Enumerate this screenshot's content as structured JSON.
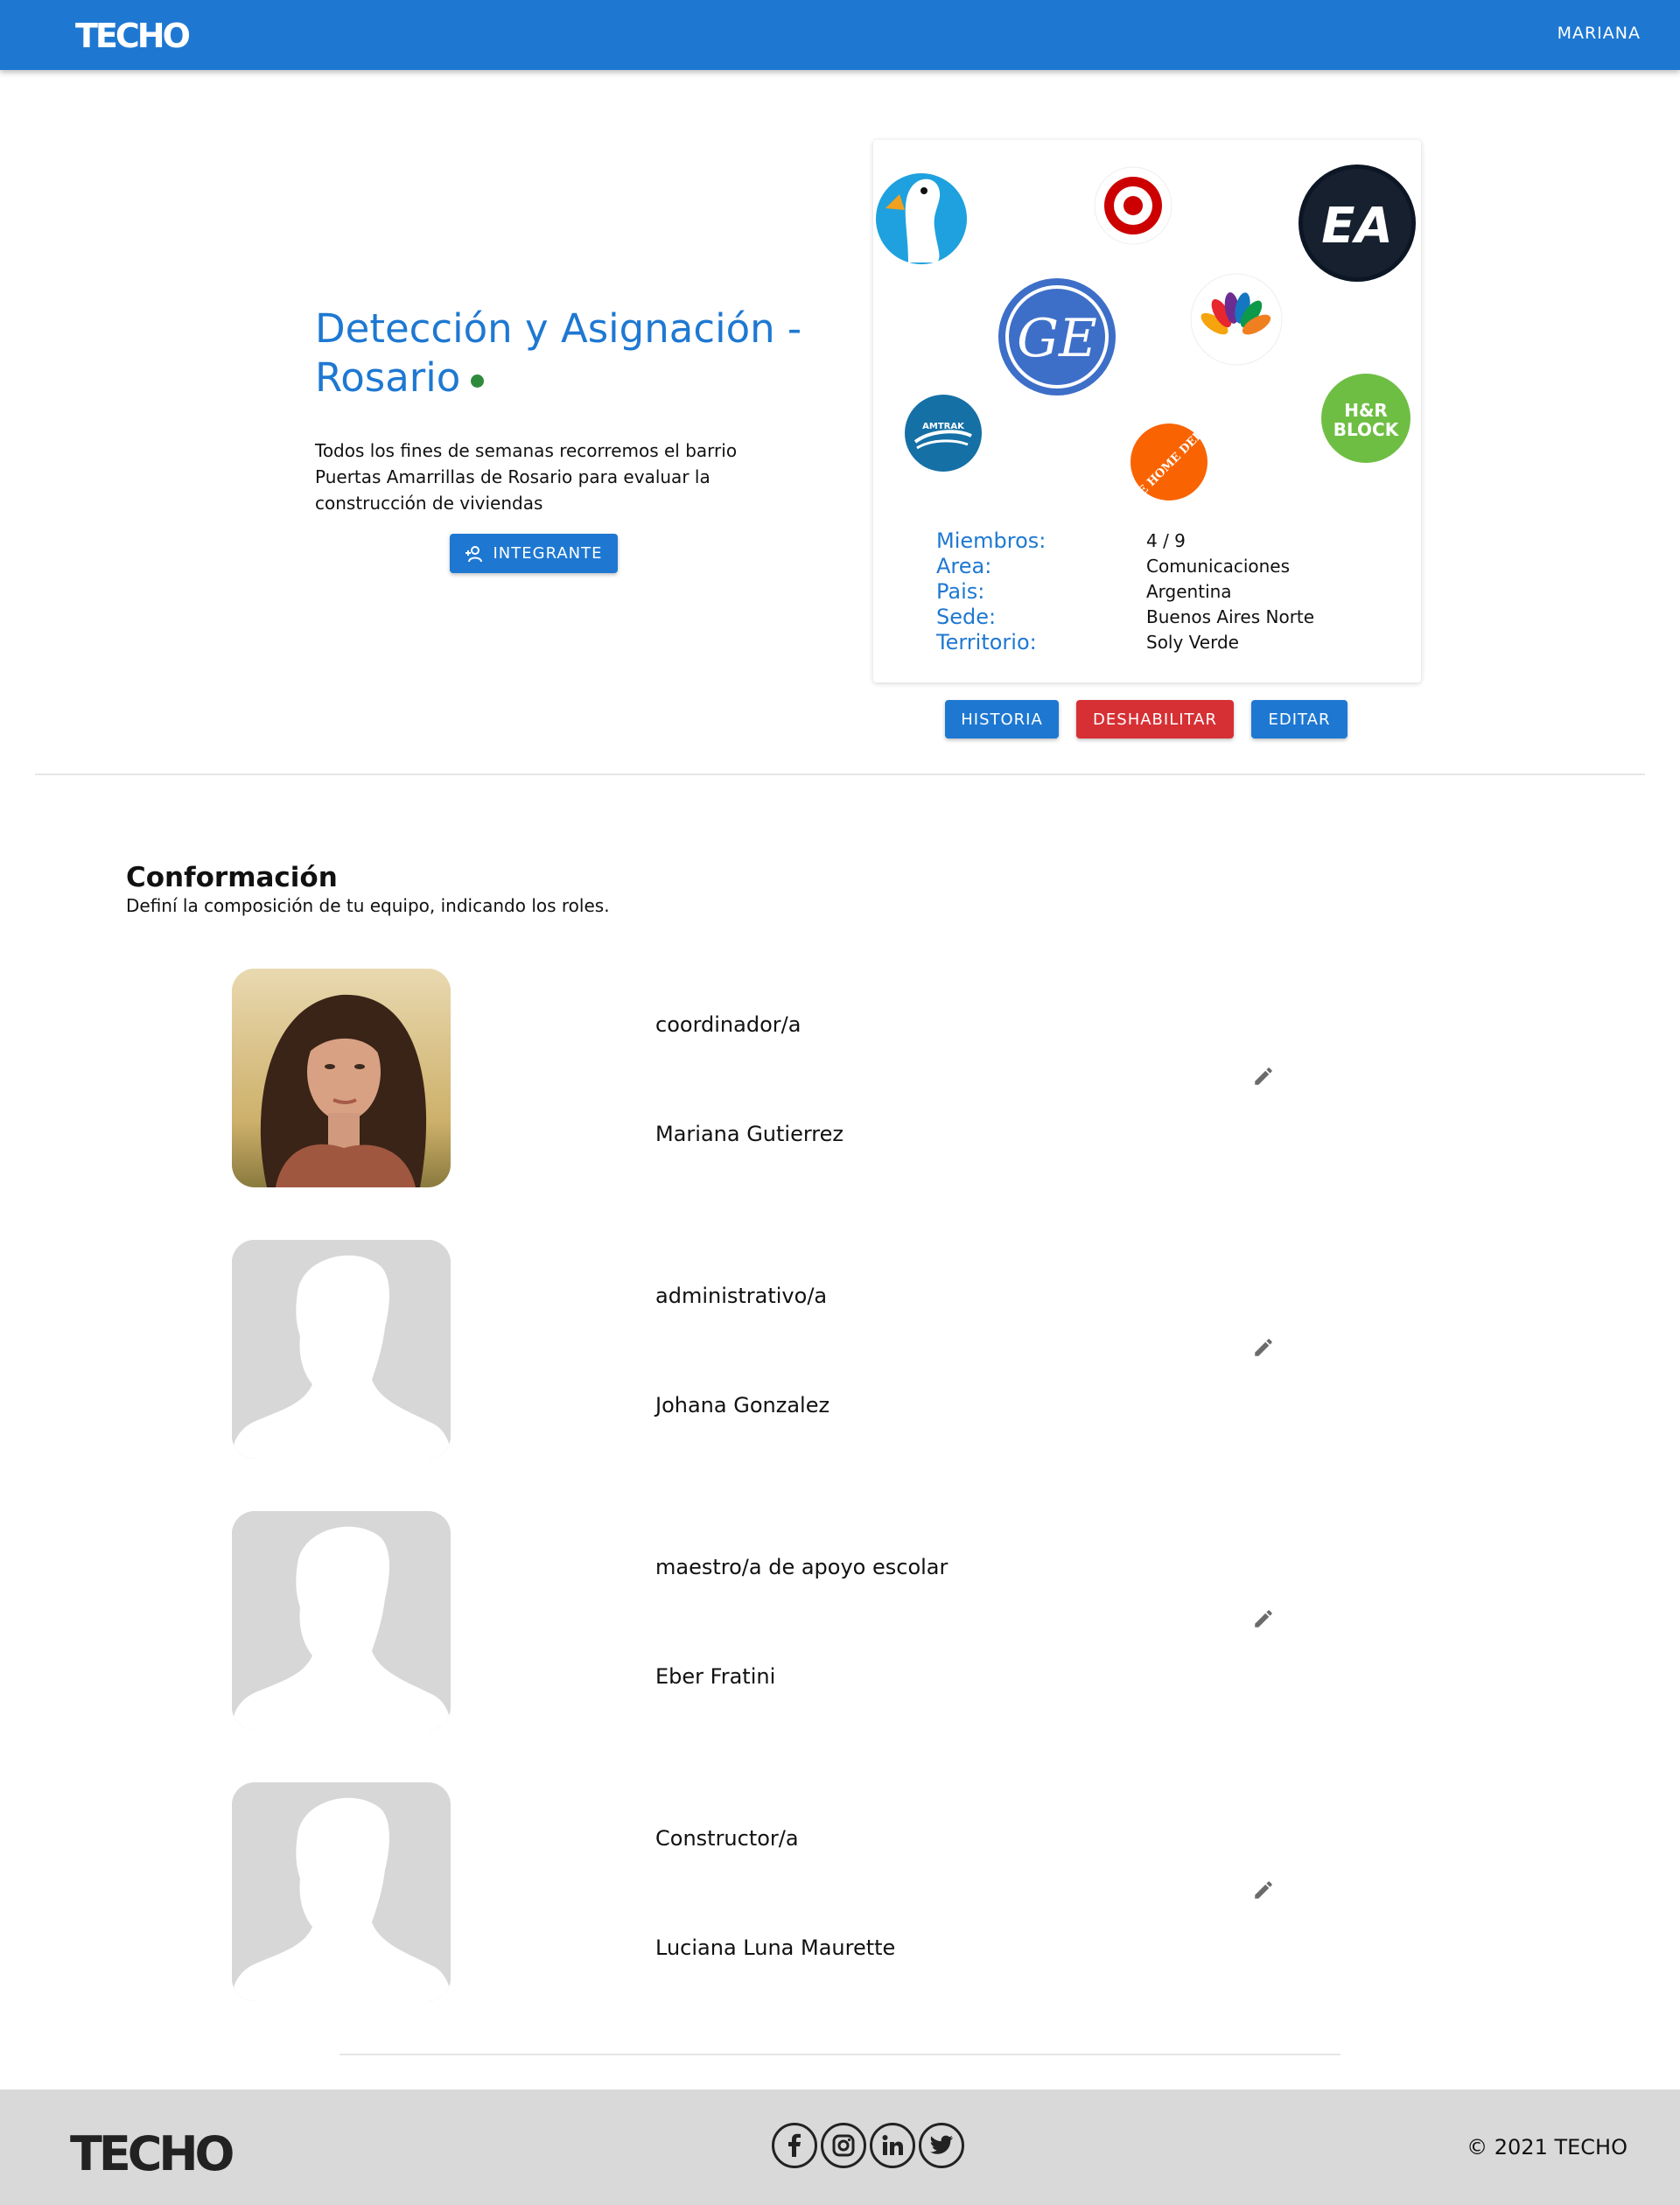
{
  "header": {
    "logo_text": "TECHO",
    "user_label": "MARIANA",
    "bar_color": "#1e78d2"
  },
  "hero": {
    "title": "Detección y Asignación - Rosario",
    "status_color": "#2e8b3c",
    "description": "Todos los fines de semanas recorremos el barrio Puertas Amarrillas de Rosario para evaluar la construcción de viviendas",
    "add_member_button": "INTEGRANTE"
  },
  "card": {
    "logos": [
      "aflac-duck-icon",
      "target-icon",
      "ea-icon",
      "ge-icon",
      "nbc-peacock-icon",
      "amtrak-icon",
      "home-depot-icon",
      "hr-block-icon"
    ],
    "logo_texts": {
      "ea": "EA",
      "ge": "GE",
      "amtrak": "AMTRAK",
      "home_depot": "THE HOME DEPOT",
      "hr_block_1": "H&R",
      "hr_block_2": "BLOCK"
    },
    "info": [
      {
        "label": "Miembros:",
        "value": "4 / 9"
      },
      {
        "label": "Area:",
        "value": "Comunicaciones"
      },
      {
        "label": "Pais:",
        "value": "Argentina"
      },
      {
        "label": "Sede:",
        "value": "Buenos Aires Norte"
      },
      {
        "label": "Territorio:",
        "value": "Soly Verde"
      }
    ]
  },
  "actions": {
    "historia": "HISTORIA",
    "deshabilitar": "DESHABILITAR",
    "editar": "EDITAR",
    "primary_color": "#1e78d2",
    "danger_color": "#d63034"
  },
  "conformacion": {
    "title": "Conformación",
    "subtitle": "Definí la composición de tu equipo, indicando los roles.",
    "members": [
      {
        "role": "coordinador/a",
        "name": "Mariana Gutierrez",
        "avatar": "photo"
      },
      {
        "role": "administrativo/a",
        "name": "Johana Gonzalez",
        "avatar": "placeholder"
      },
      {
        "role": "maestro/a de apoyo escolar",
        "name": "Eber Fratini",
        "avatar": "placeholder"
      },
      {
        "role": "Constructor/a",
        "name": "Luciana Luna Maurette",
        "avatar": "placeholder"
      }
    ]
  },
  "footer": {
    "logo_text": "TECHO",
    "social_icons": [
      "facebook-icon",
      "instagram-icon",
      "linkedin-icon",
      "twitter-icon"
    ],
    "copyright": "© 2021 TECHO"
  }
}
